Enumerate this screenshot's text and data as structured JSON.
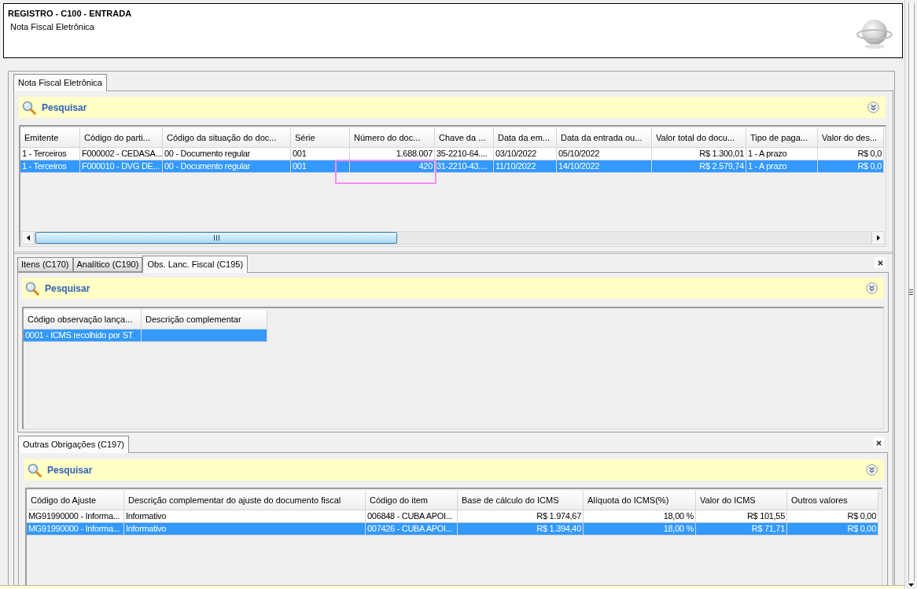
{
  "header": {
    "title": "REGISTRO - C100 - ENTRADA",
    "subtitle": "Nota Fiscal Eletrônica"
  },
  "main_tabs": [
    {
      "label": "Nota Fiscal Eletrônica",
      "selected": true
    }
  ],
  "documents": {
    "search": {
      "label": "Pesquisar"
    },
    "table": {
      "columns": [
        {
          "label": "Emitente",
          "kind": "text"
        },
        {
          "label": "Código do parti...",
          "kind": "text"
        },
        {
          "label": "Código da situação do doc...",
          "kind": "text"
        },
        {
          "label": "Série",
          "kind": "text"
        },
        {
          "label": "Número do doc...",
          "kind": "amount"
        },
        {
          "label": "Chave da ...",
          "kind": "text"
        },
        {
          "label": "Data da em...",
          "kind": "text"
        },
        {
          "label": "Data da entrada ou...",
          "kind": "text"
        },
        {
          "label": "Valor total do docu...",
          "kind": "amount"
        },
        {
          "label": "Tipo de paga...",
          "kind": "text"
        },
        {
          "label": "Valor do des...",
          "kind": "amount"
        }
      ],
      "rows": [
        {
          "selected": false,
          "cells": [
            "1 - Terceiros",
            "F000002 - CEDASA...",
            "00 - Documento regular",
            "001",
            "1.688.007",
            "35-2210-64....",
            "03/10/2022",
            "05/10/2022",
            "R$ 1.300,01",
            "1 - A prazo",
            "R$ 0,0"
          ]
        },
        {
          "selected": true,
          "cells": [
            "1 - Terceiros",
            "F000010 - DVG DE...",
            "00 - Documento regular",
            "001",
            "420",
            "31-2210-43....",
            "11/10/2022",
            "14/10/2022",
            "R$ 2.579,74",
            "1 - A prazo",
            "R$ 0,0"
          ]
        }
      ]
    }
  },
  "detail_tabs": [
    {
      "label": "Itens (C170)",
      "selected": false
    },
    {
      "label": "Analítico (C190)",
      "selected": false
    },
    {
      "label": "Obs. Lanc. Fiscal (C195)",
      "selected": true
    }
  ],
  "observations": {
    "search": {
      "label": "Pesquisar"
    },
    "table": {
      "columns": [
        {
          "label": "Código observação lança..."
        },
        {
          "label": "Descrição complementar"
        }
      ],
      "rows": [
        {
          "selected": true,
          "cells": [
            "0001 - ICMS recolhido por ST"
          ]
        }
      ]
    }
  },
  "obligation_tabs": [
    {
      "label": "Outras Obrigações (C197)",
      "selected": true
    }
  ],
  "obligations": {
    "search": {
      "label": "Pesquisar"
    },
    "table": {
      "columns": [
        {
          "label": "Código do Ajuste",
          "kind": "text"
        },
        {
          "label": "Descrição complementar do ajuste do documento fiscal",
          "kind": "text"
        },
        {
          "label": "Código do item",
          "kind": "text"
        },
        {
          "label": "Base de cálculo do ICMS",
          "kind": "amount"
        },
        {
          "label": "Alíquota do ICMS(%)",
          "kind": "amount"
        },
        {
          "label": "Valor do ICMS",
          "kind": "amount"
        },
        {
          "label": "Outros valores",
          "kind": "amount"
        }
      ],
      "rows": [
        {
          "selected": false,
          "cells": [
            "MG91990000 - Informa...",
            "Informativo",
            "006848 - CUBA APOI...",
            "R$ 1.974,67",
            "18,00 %",
            "R$ 101,55",
            "R$ 0,00"
          ]
        },
        {
          "selected": true,
          "cells": [
            "MG91990000 - Informa...",
            "Informativo",
            "007426 - CUBA APOI...",
            "R$ 1.394,40",
            "18,00 %",
            "R$ 71,71",
            "R$ 0,00"
          ]
        }
      ]
    }
  }
}
